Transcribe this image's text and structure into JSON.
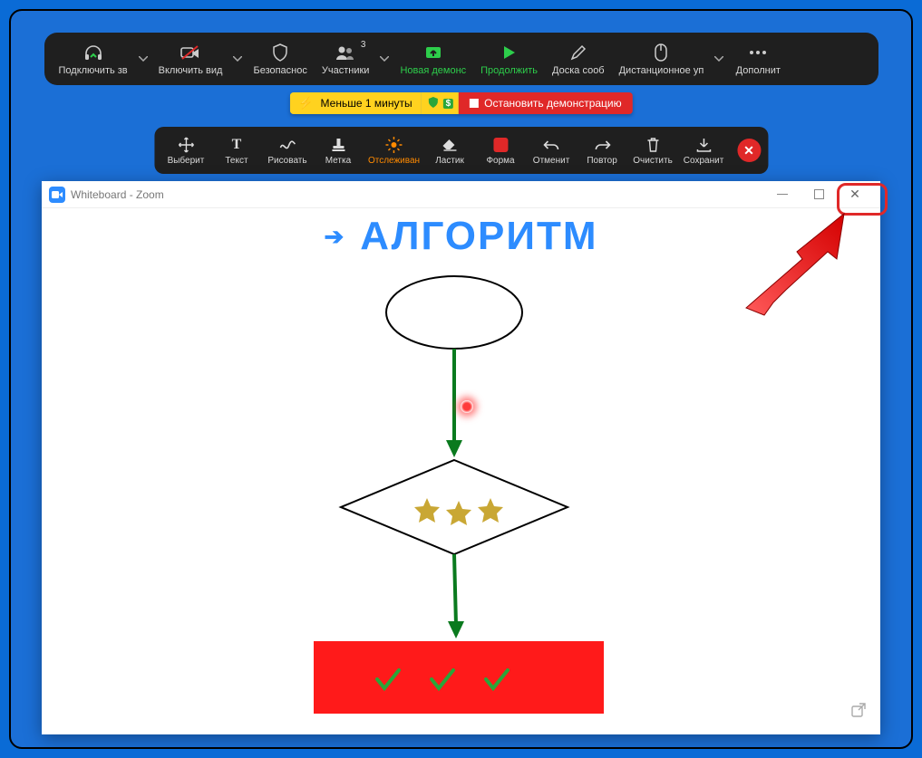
{
  "toolbar": {
    "audio": "Подключить зв",
    "video": "Включить вид",
    "security": "Безопаснос",
    "participants": "Участники",
    "participants_count": "3",
    "new_share": "Новая демонс",
    "resume": "Продолжить",
    "whiteboard": "Доска сооб",
    "remote": "Дистанционное уп",
    "more": "Дополнит"
  },
  "status": {
    "timer": "Меньше 1 минуты",
    "stop": "Остановить демонстрацию"
  },
  "anno": {
    "select": "Выберит",
    "text": "Текст",
    "draw": "Рисовать",
    "stamp": "Метка",
    "spotlight": "Отслеживан",
    "eraser": "Ластик",
    "format": "Форма",
    "undo": "Отменит",
    "redo": "Повтор",
    "clear": "Очистить",
    "save": "Сохранит"
  },
  "window": {
    "title": "Whiteboard - Zoom"
  },
  "canvas": {
    "heading": "АЛГОРИТМ"
  }
}
